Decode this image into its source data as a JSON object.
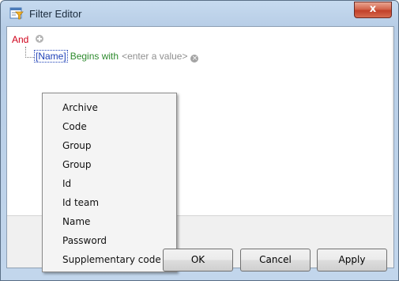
{
  "window": {
    "title": "Filter Editor",
    "close_label": "x",
    "icon": "filter-editor-icon"
  },
  "filter": {
    "group_operator": "And",
    "add_icon": "plus-circle-icon",
    "condition": {
      "field": "[Name]",
      "operator": "Begins with",
      "value_placeholder": "<enter a value>",
      "remove_icon": "remove-circle-icon"
    }
  },
  "field_dropdown": {
    "items": [
      "Archive",
      "Code",
      "Group",
      "Group",
      "Id",
      "Id team",
      "Name",
      "Password",
      "Supplementary code"
    ]
  },
  "buttons": {
    "ok": "OK",
    "cancel": "Cancel",
    "apply": "Apply"
  },
  "colors": {
    "group_operator": "#d0021b",
    "field": "#1c3fb7",
    "operator": "#2e8b2e",
    "placeholder": "#8f8f8f",
    "close_button": "#c1402a"
  }
}
